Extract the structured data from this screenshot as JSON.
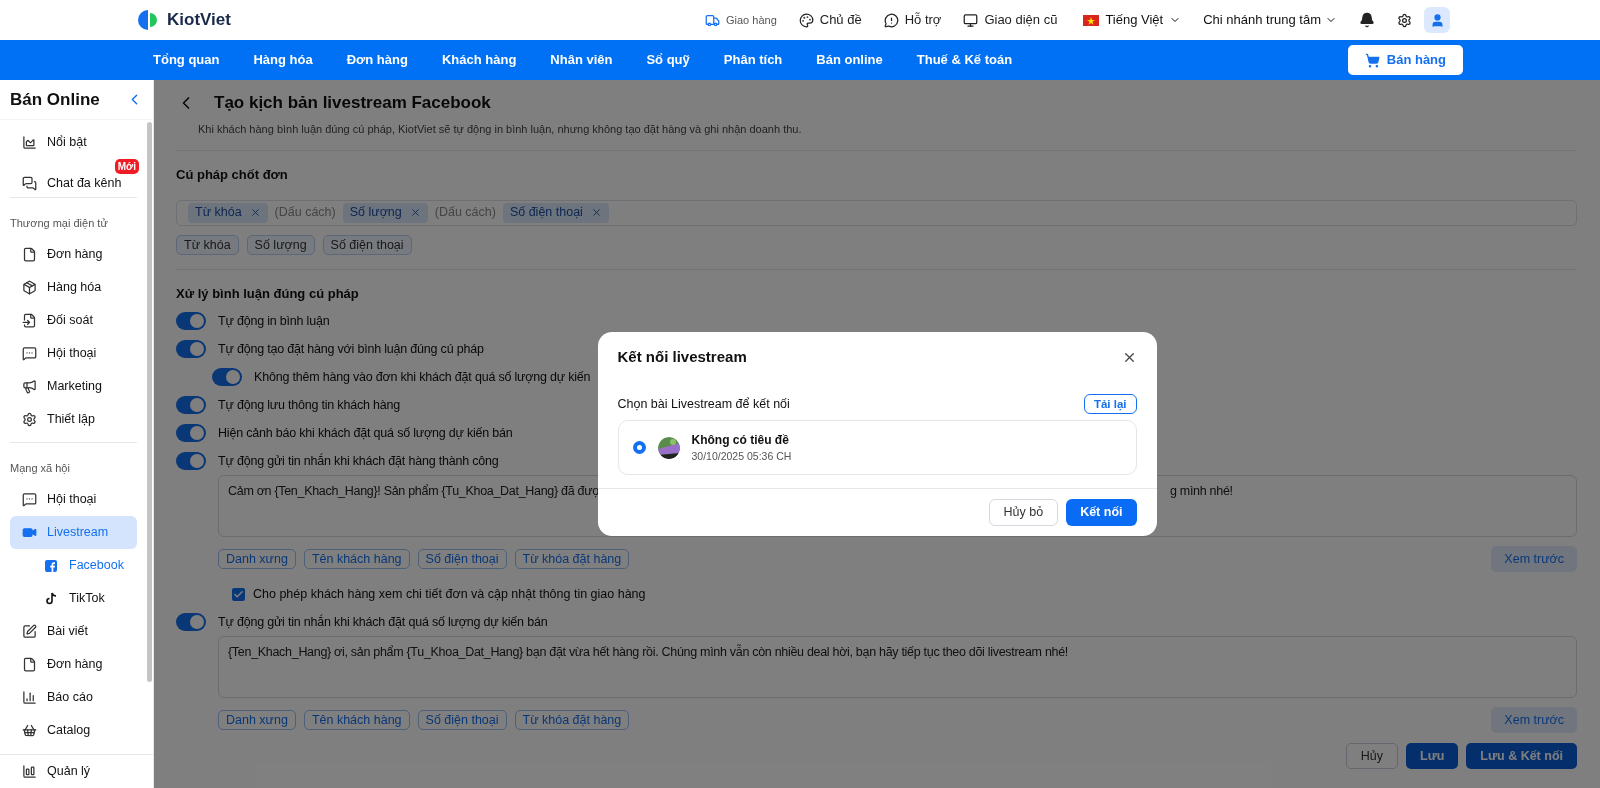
{
  "header": {
    "logo_text": "KiotViet",
    "links": [
      {
        "label": "Giao hàng",
        "kind": "small"
      },
      {
        "label": "Chủ đề",
        "kind": "normal"
      },
      {
        "label": "Hỗ trợ",
        "kind": "normal"
      },
      {
        "label": "Giao diện cũ",
        "kind": "normal"
      }
    ],
    "language": "Tiếng Việt",
    "branch": "Chi nhánh trung tâm"
  },
  "nav": {
    "items": [
      "Tổng quan",
      "Hàng hóa",
      "Đơn hàng",
      "Khách hàng",
      "Nhân viên",
      "Sổ quỹ",
      "Phân tích",
      "Bán online",
      "Thuế & Kế toán"
    ],
    "sell_button": "Bán hàng"
  },
  "sidebar": {
    "title": "Bán Online",
    "items": [
      {
        "kind": "item",
        "label": "Nổi bật",
        "selected": false
      },
      {
        "kind": "item",
        "label": "Chat đa kênh",
        "selected": false,
        "badge": "Mới"
      },
      {
        "kind": "heading",
        "label": "Thương mại điện tử"
      },
      {
        "kind": "item",
        "label": "Đơn hàng",
        "selected": false
      },
      {
        "kind": "item",
        "label": "Hàng hóa",
        "selected": false
      },
      {
        "kind": "item",
        "label": "Đối soát",
        "selected": false
      },
      {
        "kind": "item",
        "label": "Hội thoại",
        "selected": false
      },
      {
        "kind": "item",
        "label": "Marketing",
        "selected": false
      },
      {
        "kind": "item",
        "label": "Thiết lập",
        "selected": false
      },
      {
        "kind": "heading",
        "label": "Mạng xã hội"
      },
      {
        "kind": "item",
        "label": "Hội thoại",
        "selected": false
      },
      {
        "kind": "item",
        "label": "Livestream",
        "selected": true,
        "children": [
          {
            "label": "Facebook",
            "selected": true
          },
          {
            "label": "TikTok",
            "selected": false
          }
        ]
      },
      {
        "kind": "item",
        "label": "Bài viết",
        "selected": false
      },
      {
        "kind": "item",
        "label": "Đơn hàng",
        "selected": false
      },
      {
        "kind": "item",
        "label": "Báo cáo",
        "selected": false
      },
      {
        "kind": "item",
        "label": "Catalog",
        "selected": false
      }
    ],
    "bottom_item": "Quản lý"
  },
  "page": {
    "title": "Tạo kịch bản livestream Facebook",
    "description": "Khi khách hàng bình luận đúng cú pháp, KiotViet sẽ tự động in bình luận, nhưng không tạo đặt hàng và ghi nhận doanh thu.",
    "syntax": {
      "heading": "Cú pháp chốt đơn",
      "tokens": [
        {
          "kind": "token",
          "label": "Từ khóa"
        },
        {
          "kind": "separator",
          "label": "(Dấu cách)"
        },
        {
          "kind": "token",
          "label": "Số lượng"
        },
        {
          "kind": "separator",
          "label": "(Dấu cách)"
        },
        {
          "kind": "token",
          "label": "Số điện thoại"
        }
      ],
      "suggestions": [
        "Từ khóa",
        "Số lượng",
        "Số điện thoại"
      ]
    },
    "processing": {
      "heading": "Xử lý bình luận đúng cú pháp",
      "settings": [
        {
          "kind": "toggle",
          "label": "Tự động in bình luận",
          "on": true
        },
        {
          "kind": "toggle",
          "label": "Tự động tạo đặt hàng với bình luận đúng cú pháp",
          "on": true,
          "children": [
            {
              "kind": "toggle",
              "label": "Không thêm hàng vào đơn khi khách đặt quá số lượng dự kiến",
              "on": true
            }
          ]
        },
        {
          "kind": "toggle",
          "label": "Tự động lưu thông tin khách hàng",
          "on": true
        },
        {
          "kind": "toggle",
          "label": "Hiện cảnh báo khi khách đặt quá số lượng dự kiến bán",
          "on": true
        },
        {
          "kind": "toggle",
          "label": "Tự động gửi tin nhắn khi khách đặt hàng thành công",
          "on": true
        },
        {
          "kind": "message",
          "text": "Cảm ơn {Ten_Khach_Hang}! Sản phẩm {Tu_Khoa_Dat_Hang} đã đượ",
          "text_end": "g mình nhé!",
          "chips": [
            "Danh xưng",
            "Tên khách hàng",
            "Số điện thoại",
            "Từ khóa đặt hàng"
          ],
          "preview": "Xem trước"
        },
        {
          "kind": "checkbox",
          "label": "Cho phép khách hàng xem chi tiết đơn và cập nhật thông tin giao hàng",
          "checked": true
        },
        {
          "kind": "toggle",
          "label": "Tự động gửi tin nhắn khi khách đặt quá số lượng dự kiến bán",
          "on": true
        },
        {
          "kind": "message",
          "text": "{Ten_Khach_Hang} ơi, sản phẩm {Tu_Khoa_Dat_Hang} bạn đặt vừa hết hàng rồi. Chúng mình vẫn còn nhiều deal hời, bạn hãy tiếp tục theo dõi livestream nhé!",
          "chips": [
            "Danh xưng",
            "Tên khách hàng",
            "Số điện thoại",
            "Từ khóa đặt hàng"
          ],
          "preview": "Xem trước"
        }
      ]
    },
    "footer_buttons": [
      {
        "label": "Hủy",
        "kind": "outline"
      },
      {
        "label": "Lưu",
        "kind": "primary"
      },
      {
        "label": "Lưu & Kết nối",
        "kind": "primary"
      }
    ]
  },
  "modal": {
    "title": "Kết nối livestream",
    "prompt": "Chọn bài Livestream để kết nối",
    "reload": "Tải lại",
    "streams": [
      {
        "title": "Không có tiêu đề",
        "time": "30/10/2025 05:36 CH",
        "selected": true
      }
    ],
    "buttons": [
      {
        "label": "Hủy bỏ",
        "kind": "outline"
      },
      {
        "label": "Kết nối",
        "kind": "primary"
      }
    ]
  }
}
